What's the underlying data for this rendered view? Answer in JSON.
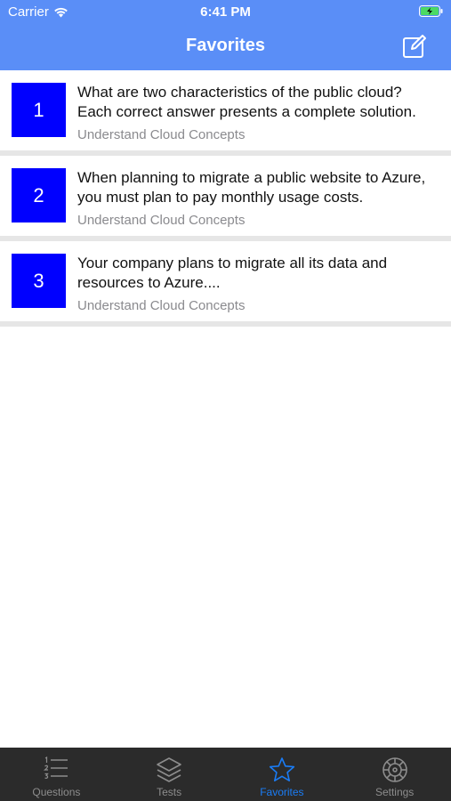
{
  "status_bar": {
    "carrier": "Carrier",
    "time": "6:41 PM"
  },
  "header": {
    "title": "Favorites"
  },
  "favorites": [
    {
      "number": "1",
      "question": "What are two characteristics of the public cloud? Each correct answer presents a complete solution.",
      "category": "Understand Cloud Concepts"
    },
    {
      "number": "2",
      "question": "When planning to migrate a public website to Azure, you must plan to pay monthly usage costs.",
      "category": "Understand Cloud Concepts"
    },
    {
      "number": "3",
      "question": "Your company plans to migrate all its data and resources to Azure....",
      "category": "Understand Cloud Concepts"
    }
  ],
  "tabs": [
    {
      "label": "Questions",
      "icon": "list-icon"
    },
    {
      "label": "Tests",
      "icon": "layers-icon"
    },
    {
      "label": "Favorites",
      "icon": "star-icon"
    },
    {
      "label": "Settings",
      "icon": "gear-icon"
    }
  ],
  "colors": {
    "header": "#5a8ef7",
    "number_box": "#0000ff",
    "tab_active": "#1a7cf5",
    "tabbar": "#2b2b2b"
  }
}
